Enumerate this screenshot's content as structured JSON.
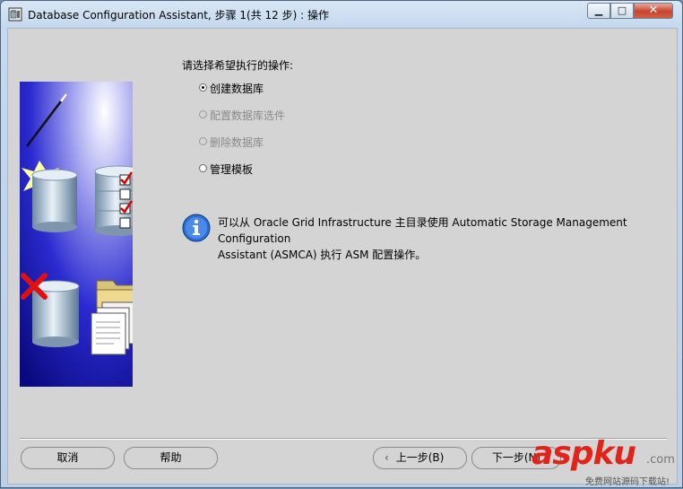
{
  "window": {
    "title": "Database Configuration Assistant, 步骤 1(共 12 步) : 操作",
    "controls": {
      "minimize": "▁",
      "maximize": "□",
      "close": "✕"
    }
  },
  "main": {
    "prompt": "请选择希望执行的操作:",
    "options": [
      {
        "label": "创建数据库",
        "selected": true,
        "enabled": true
      },
      {
        "label": "配置数据库选件",
        "selected": false,
        "enabled": false
      },
      {
        "label": "删除数据库",
        "selected": false,
        "enabled": false
      },
      {
        "label": "管理模板",
        "selected": false,
        "enabled": true
      }
    ],
    "info": {
      "icon": "info-icon",
      "line1": "可以从 Oracle Grid Infrastructure 主目录使用 Automatic Storage Management Configuration",
      "line2": "Assistant (ASMCA) 执行 ASM 配置操作。"
    }
  },
  "footer": {
    "cancel_label": "取消",
    "help_label": "帮助",
    "back_label": "上一步(B)",
    "next_label": "下一步(N)"
  },
  "watermark": {
    "main": "aspku",
    "suffix": ".com",
    "sub": "免费网站源码下载站!"
  },
  "colors": {
    "accent": "#2a2ad0",
    "close_red": "#c7442e",
    "watermark_red": "#e2231a"
  }
}
